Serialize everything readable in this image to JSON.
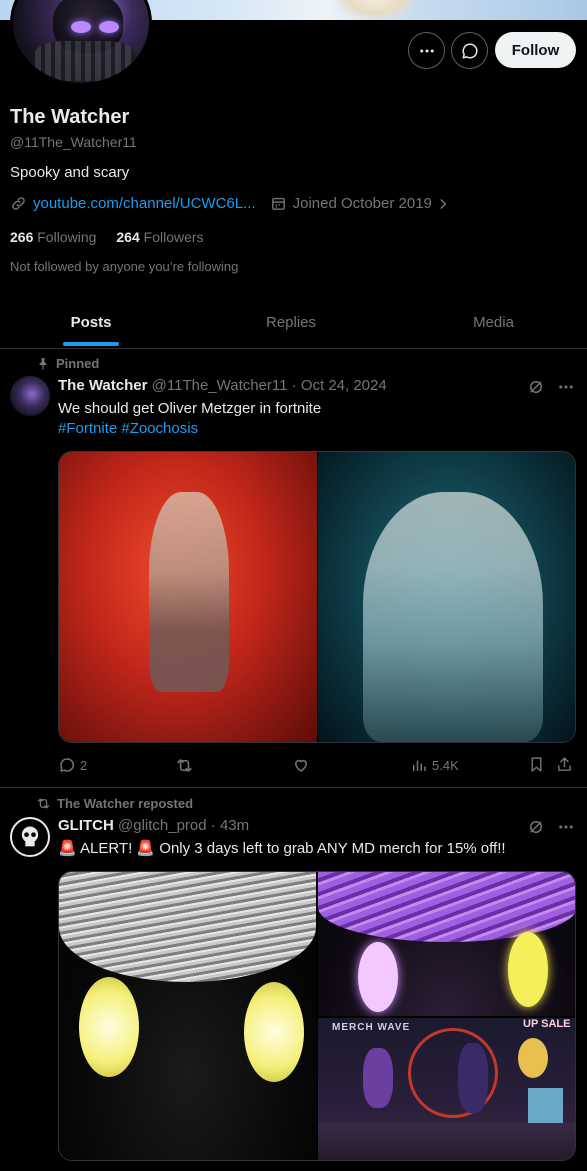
{
  "profile": {
    "name": "The Watcher",
    "handle": "@11The_Watcher11",
    "bio": "Spooky and scary",
    "link": "youtube.com/channel/UCWC6L...",
    "joined": "Joined October 2019",
    "following_count": "266",
    "following_label": "Following",
    "followers_count": "264",
    "followers_label": "Followers",
    "not_followed_text": "Not followed by anyone you’re following",
    "follow_button": "Follow"
  },
  "tabs": [
    {
      "label": "Posts",
      "active": true
    },
    {
      "label": "Replies",
      "active": false
    },
    {
      "label": "Media",
      "active": false
    }
  ],
  "posts": [
    {
      "context": "Pinned",
      "author": "The Watcher",
      "handle_time": "@11The_Watcher11 · Oct 24, 2024",
      "text": "We should get Oliver Metzger in fortnite",
      "hashtags": "#Fortnite #Zoochosis",
      "replies": "2",
      "views": "5.4K"
    },
    {
      "context": "The Watcher reposted",
      "author": "GLITCH",
      "handle_time": "@glitch_prod · 43m",
      "text": "🚨 ALERT! 🚨 Only 3 days left to grab ANY MD merch for 15% off!!",
      "merch_banner_left": "MERCH WAVE",
      "merch_banner_right": "UP SALE"
    }
  ],
  "colors": {
    "accent": "#1d9bf0",
    "text": "#e7e9ea",
    "muted": "#71767b",
    "border": "#2f3336",
    "follow_bg": "#eff3f4"
  },
  "icons": [
    "more-icon",
    "message-icon",
    "link-icon",
    "calendar-icon",
    "chevron-right-icon",
    "pin-icon",
    "repost-icon",
    "reply-icon",
    "like-icon",
    "views-icon",
    "bookmark-icon",
    "share-icon",
    "grok-icon"
  ]
}
